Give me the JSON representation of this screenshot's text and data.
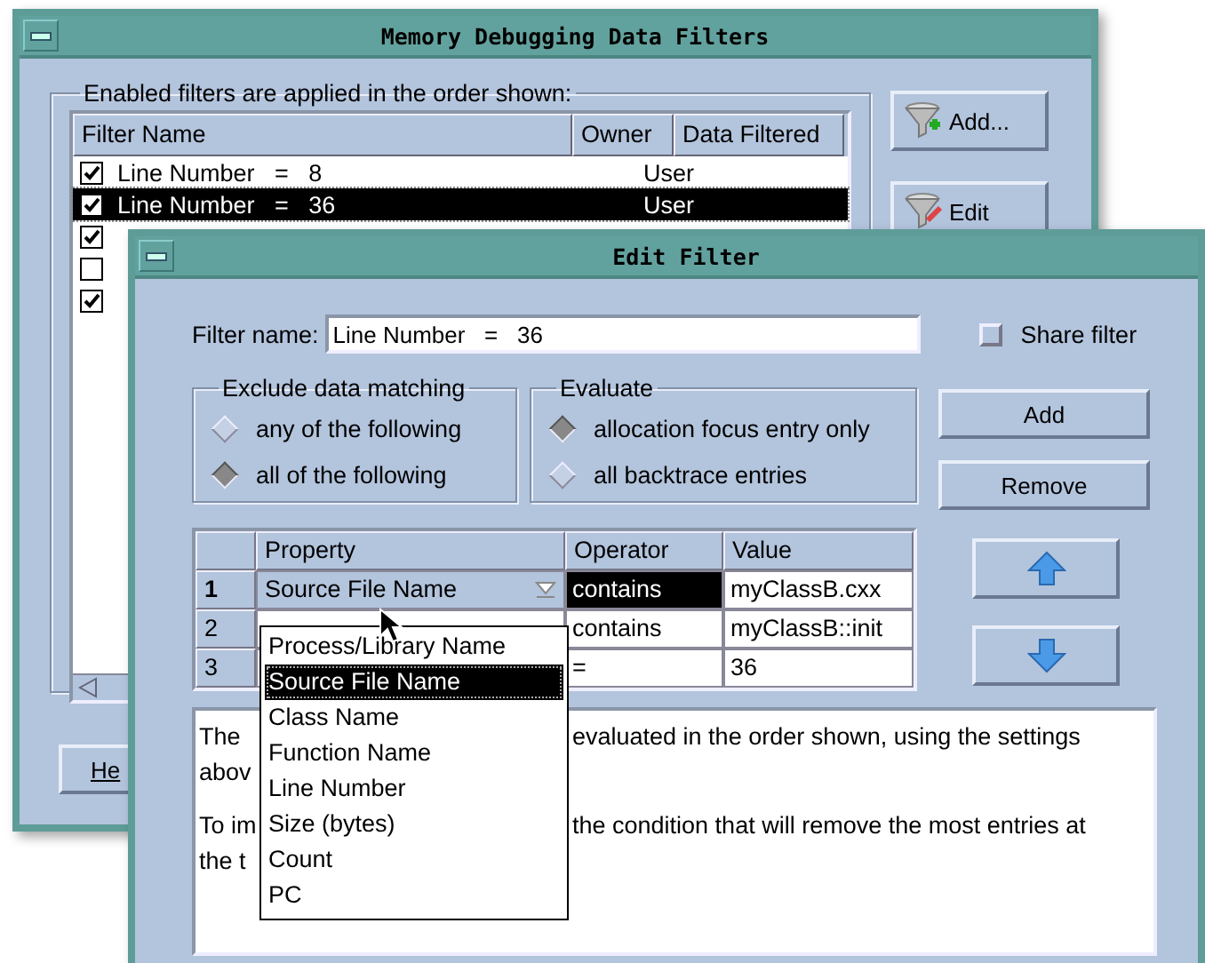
{
  "back_window": {
    "title": "Memory Debugging Data Filters",
    "group_label": "Enabled filters are applied in the order shown:",
    "columns": [
      "Filter Name",
      "Owner",
      "Data Filtered"
    ],
    "rows": [
      {
        "checked": true,
        "name": "Line Number   =   8",
        "owner": "User",
        "selected": false
      },
      {
        "checked": true,
        "name": "Line Number   =   36",
        "owner": "User",
        "selected": true
      },
      {
        "checked": true,
        "selected": false
      },
      {
        "checked": false,
        "selected": false
      },
      {
        "checked": true,
        "selected": false
      }
    ],
    "buttons": [
      {
        "label": "Add...",
        "kind": "add"
      },
      {
        "label": "Edit",
        "kind": "edit"
      }
    ],
    "help_button": "He"
  },
  "edit_window": {
    "title": "Edit Filter",
    "filter_name_label": "Filter name:",
    "filter_name": "Line Number   =   36",
    "share_filter": {
      "label": "Share filter",
      "checked": false
    },
    "exclude": {
      "label": "Exclude data matching",
      "options": [
        {
          "label": "any of the following",
          "selected": false
        },
        {
          "label": "all of the following",
          "selected": true
        }
      ]
    },
    "evaluate": {
      "label": "Evaluate",
      "options": [
        {
          "label": "allocation focus entry only",
          "selected": true
        },
        {
          "label": "all backtrace entries",
          "selected": false
        }
      ]
    },
    "buttons": [
      "Add",
      "Remove"
    ],
    "table": {
      "columns": [
        "Property",
        "Operator",
        "Value"
      ],
      "rows": [
        {
          "number": "1",
          "property": "Source File Name",
          "operator": "contains",
          "value": "myClassB.cxx",
          "selected": true
        },
        {
          "number": "2",
          "operator": "contains",
          "value": "myClassB::init",
          "selected": false
        },
        {
          "number": "3",
          "operator": "=",
          "value": "36",
          "selected": false
        }
      ]
    },
    "property_menu": [
      {
        "label": "Process/Library Name",
        "selected": false
      },
      {
        "label": "Source File Name",
        "selected": true
      },
      {
        "label": "Class Name",
        "selected": false
      },
      {
        "label": "Function Name",
        "selected": false
      },
      {
        "label": "Line Number",
        "selected": false
      },
      {
        "label": "Size (bytes)",
        "selected": false
      },
      {
        "label": "Count",
        "selected": false
      },
      {
        "label": "PC",
        "selected": false
      }
    ],
    "description": [
      {
        "left": "The",
        "right": "evaluated in the order shown, using the settings"
      },
      {
        "left": "abov"
      },
      {
        "left": "To im",
        "right": "the condition that will remove the most entries at"
      },
      {
        "left": "the t"
      }
    ]
  }
}
